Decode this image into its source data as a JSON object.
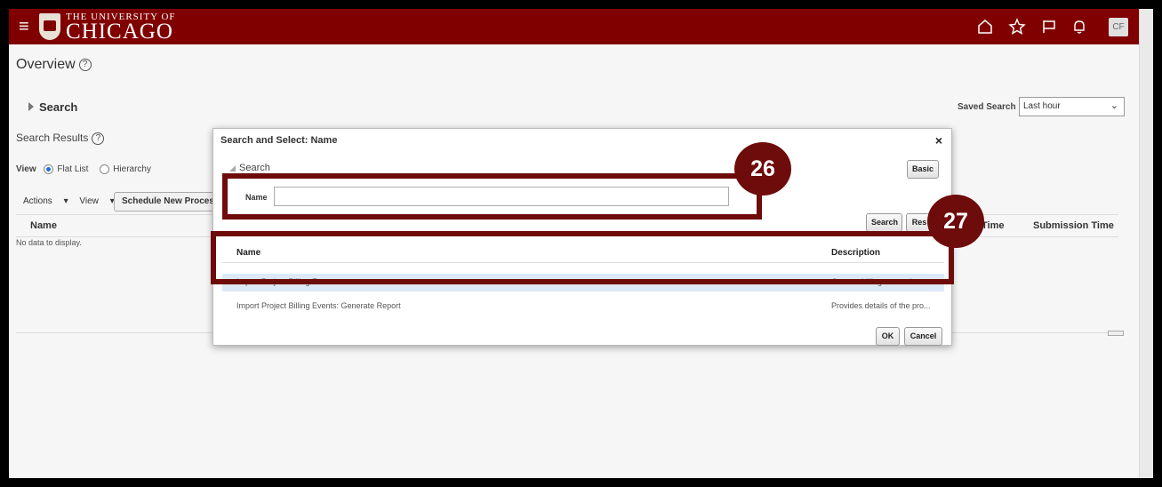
{
  "header": {
    "logo_small": "THE UNIVERSITY OF",
    "logo_big": "CHICAGO",
    "avatar_initials": "CF",
    "icons": [
      "menu-icon",
      "home-icon",
      "star-icon",
      "flag-icon",
      "bell-icon"
    ],
    "bar_color": "#800000"
  },
  "page": {
    "title": "Overview",
    "search_toggle": "Search",
    "saved_search_label": "Saved Search",
    "saved_search_value": "Last hour",
    "results_label": "Search Results",
    "view_label": "View",
    "view_options": [
      "Flat List",
      "Hierarchy"
    ],
    "actions_label": "Actions",
    "view_menu_label": "View",
    "schedule_button": "Schedule New Process",
    "columns": [
      "Name",
      "Time",
      "Submission Time"
    ],
    "no_data": "No data to display."
  },
  "modal": {
    "title": "Search and Select: Name",
    "close": "×",
    "search_label": "Search",
    "basic_button": "Basic",
    "name_label": "Name",
    "name_value": "",
    "search_button": "Search",
    "reset_button": "Res",
    "columns": {
      "name": "Name",
      "description": "Description"
    },
    "rows": [
      {
        "name": "Import Project Billing Events",
        "description": "Creates billing events in"
      },
      {
        "name": "Import Project Billing Events: Generate Report",
        "description": "Provides details of the pro..."
      }
    ],
    "ok_button": "OK",
    "cancel_button": "Cancel"
  },
  "callouts": {
    "first": "26",
    "second": "27",
    "color": "#6e0b0b"
  }
}
